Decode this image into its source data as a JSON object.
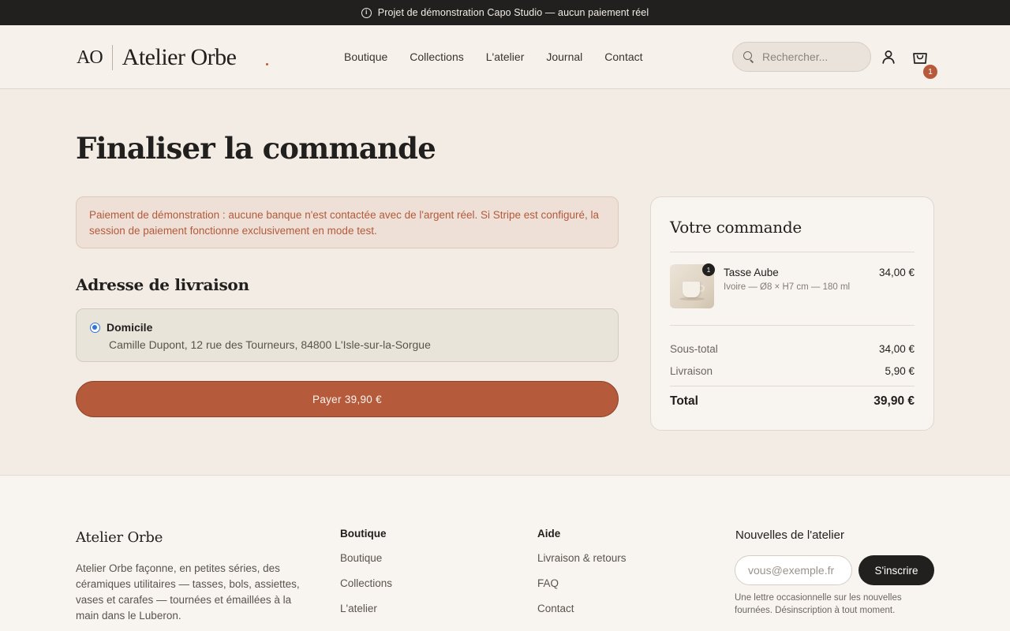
{
  "topbar": {
    "text": "Projet de démonstration Capo Studio — aucun paiement réel",
    "icon": "info-icon"
  },
  "header": {
    "logo_mark": "AO",
    "logo_name": "Atelier Orbe",
    "nav": [
      "Boutique",
      "Collections",
      "L'atelier",
      "Journal",
      "Contact"
    ],
    "search_placeholder": "Rechercher...",
    "cart_count": "1"
  },
  "checkout": {
    "title": "Finaliser la commande",
    "notice": "Paiement de démonstration : aucune banque n'est contactée avec de l'argent réel. Si Stripe est configuré, la session de paiement fonctionne exclusivement en mode test.",
    "shipping_title": "Adresse de livraison",
    "address": {
      "label": "Domicile",
      "line": "Camille Dupont, 12 rue des Tourneurs, 84800 L'Isle-sur-la-Sorgue",
      "selected": true
    },
    "pay_label": "Payer 39,90 €"
  },
  "summary": {
    "title": "Votre commande",
    "item": {
      "qty": "1",
      "name": "Tasse Aube",
      "variant": "Ivoire — Ø8 × H7 cm — 180 ml",
      "price": "34,00 €"
    },
    "subtotal_label": "Sous-total",
    "subtotal_value": "34,00 €",
    "shipping_label": "Livraison",
    "shipping_value": "5,90 €",
    "total_label": "Total",
    "total_value": "39,90 €"
  },
  "footer": {
    "brand": "Atelier Orbe",
    "description": "Atelier Orbe façonne, en petites séries, des céramiques utilitaires — tasses, bols, assiettes, vases et carafes — tournées et émaillées à la main dans le Luberon.",
    "shop": {
      "title": "Boutique",
      "links": [
        "Boutique",
        "Collections",
        "L'atelier"
      ]
    },
    "help": {
      "title": "Aide",
      "links": [
        "Livraison & retours",
        "FAQ",
        "Contact"
      ]
    },
    "newsletter": {
      "title": "Nouvelles de l'atelier",
      "placeholder": "vous@exemple.fr",
      "button": "S'inscrire",
      "note": "Une lettre occasionnelle sur les nouvelles fournées. Désinscription à tout moment."
    }
  },
  "colors": {
    "accent": "#b55b3c",
    "dark": "#22201e",
    "background": "#f3ece4",
    "link": "#2f74d6"
  }
}
